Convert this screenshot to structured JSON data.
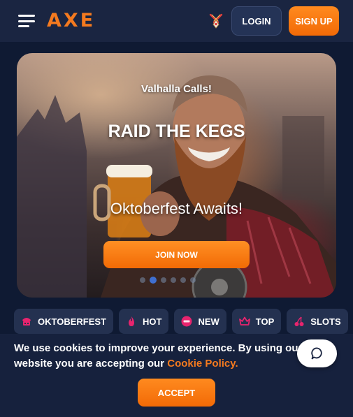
{
  "header": {
    "logo": "AXE",
    "login_label": "LOGIN",
    "signup_label": "SIGN UP"
  },
  "hero": {
    "subtitle": "Valhalla Calls!",
    "title": "RAID THE KEGS",
    "tagline": "Oktoberfest Awaits!",
    "cta_label": "JOIN NOW",
    "slides_total": 6,
    "active_slide": 2
  },
  "categories": [
    {
      "label": "OKTOBERFEST",
      "icon": "oktoberfest-icon"
    },
    {
      "label": "HOT",
      "icon": "flame-icon"
    },
    {
      "label": "NEW",
      "icon": "new-badge-icon"
    },
    {
      "label": "TOP",
      "icon": "crown-icon"
    },
    {
      "label": "SLOTS",
      "icon": "cherries-icon"
    }
  ],
  "cookie": {
    "text_before": "We use cookies to improve your experience. By using our website you are accepting our ",
    "link_label": "Cookie Policy.",
    "accept_label": "ACCEPT"
  },
  "colors": {
    "accent": "#f47a1f",
    "header_bg": "#1a2541",
    "page_bg": "#0f1a33",
    "chip_bg": "#243150",
    "chip_icon": "#e8246e",
    "dot_active": "#3f6fd0"
  }
}
